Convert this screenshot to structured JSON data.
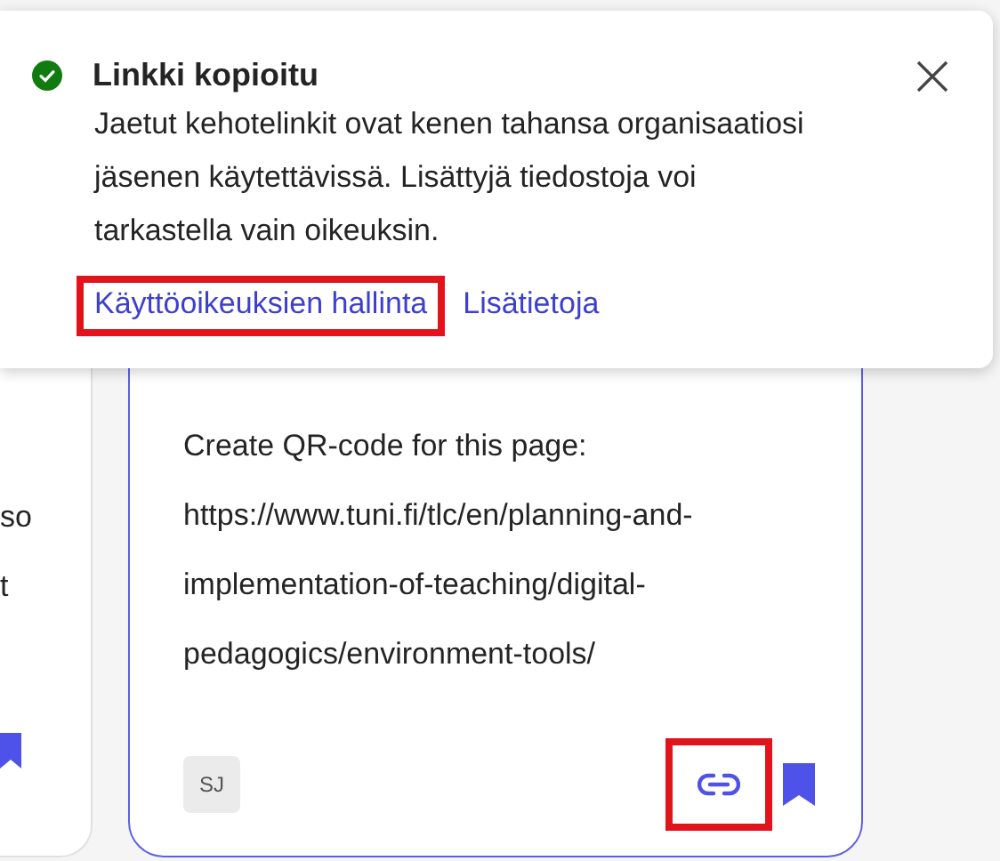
{
  "toast": {
    "success": true,
    "title": "Linkki kopioitu",
    "message": "Jaetut kehotelinkit ovat kenen tahansa organisaatiosi jäsenen käytettävissä. Lisättyjä tiedostoja voi tarkastella vain oikeuksin.",
    "links": [
      {
        "label": "Käyttöoikeuksien hallinta",
        "highlighted": true
      },
      {
        "label": "Lisätietoja",
        "highlighted": false
      }
    ]
  },
  "left_card": {
    "lines": [
      "so",
      "t"
    ]
  },
  "card": {
    "text": "Create QR-code for this page: https://www.tuni.fi/tlc/en/planning-and-implementation-of-teaching/digital-pedagogics/environment-tools/",
    "author_initials": "SJ",
    "copy_link_highlighted": true
  }
}
